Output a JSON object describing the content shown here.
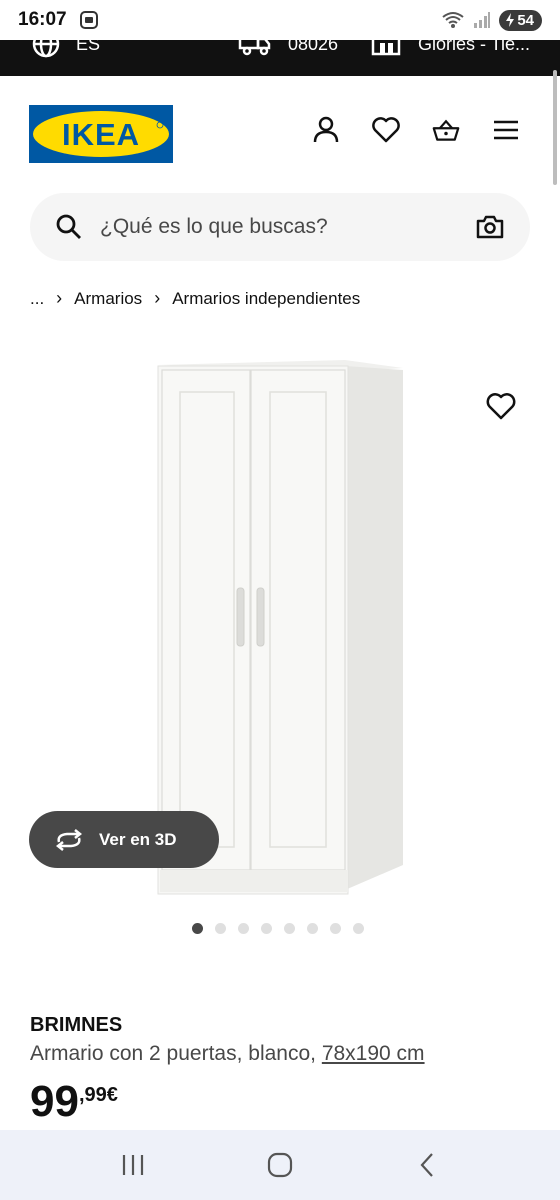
{
  "status_bar": {
    "time": "16:07",
    "battery": "54",
    "icons": [
      "screenshot-icon",
      "wifi-icon",
      "signal-icon",
      "battery-icon"
    ]
  },
  "top_bar": {
    "language": "ES",
    "postcode": "08026",
    "store": "Glories - Tie..."
  },
  "header": {
    "logo_text": "IKEA",
    "icons": [
      "user-icon",
      "heart-icon",
      "basket-icon",
      "menu-icon"
    ]
  },
  "search": {
    "placeholder": "¿Qué es lo que buscas?"
  },
  "breadcrumb": {
    "ellipsis": "...",
    "items": [
      "Armarios",
      "Armarios independientes"
    ]
  },
  "product": {
    "view_3d_label": "Ver en 3D",
    "carousel": {
      "total": 8,
      "active": 0
    },
    "name": "BRIMNES",
    "description": "Armario con 2 puertas, blanco,",
    "dimensions": "78x190 cm",
    "price_integer": "99",
    "price_decimal": ",99€"
  },
  "colors": {
    "ikea_blue": "#0058a3",
    "ikea_yellow": "#ffdb00",
    "dark_grey": "#484848",
    "top_bar": "#111111"
  }
}
